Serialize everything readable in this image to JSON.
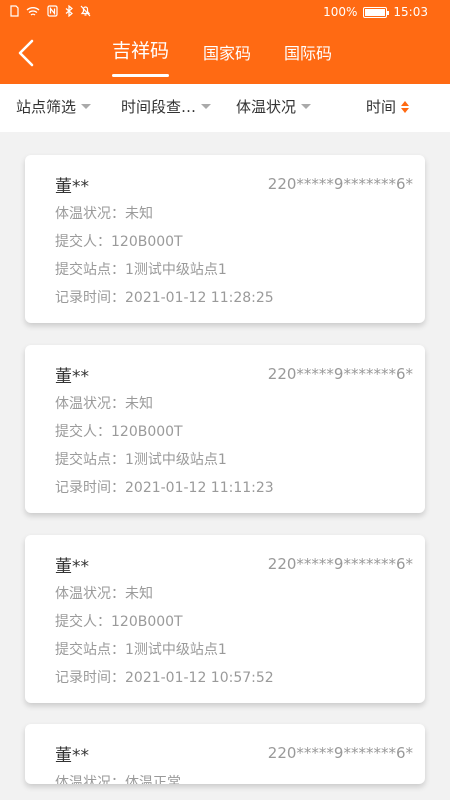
{
  "status_bar": {
    "left_icons": [
      "sim-icon",
      "wifi-icon",
      "nfc-icon",
      "bluetooth-icon",
      "mute-icon"
    ],
    "battery_text": "100%",
    "battery_level": 1.0,
    "time": "15:03"
  },
  "header": {
    "accent_color": "#ff6a13",
    "tabs": [
      {
        "label": "吉祥码",
        "active": true
      },
      {
        "label": "国家码",
        "active": false
      },
      {
        "label": "国际码",
        "active": false
      }
    ]
  },
  "filters": {
    "station": "站点筛选",
    "time_range": "时间段查…",
    "temperature": "体温状况",
    "sort_time": "时间"
  },
  "records": [
    {
      "name": "董**",
      "id": "220*****9*******6*",
      "temp_label": "体温状况：",
      "temp": "未知",
      "submitter_label": "提交人：",
      "submitter": "120B000T",
      "station_label": "提交站点：",
      "station": "1测试中级站点1",
      "time_label": "记录时间：",
      "time": "2021-01-12 11:28:25"
    },
    {
      "name": "董**",
      "id": "220*****9*******6*",
      "temp_label": "体温状况：",
      "temp": "未知",
      "submitter_label": "提交人：",
      "submitter": "120B000T",
      "station_label": "提交站点：",
      "station": "1测试中级站点1",
      "time_label": "记录时间：",
      "time": "2021-01-12 11:11:23"
    },
    {
      "name": "董**",
      "id": "220*****9*******6*",
      "temp_label": "体温状况：",
      "temp": "未知",
      "submitter_label": "提交人：",
      "submitter": "120B000T",
      "station_label": "提交站点：",
      "station": "1测试中级站点1",
      "time_label": "记录时间：",
      "time": "2021-01-12 10:57:52"
    },
    {
      "name": "董**",
      "id": "220*****9*******6*",
      "temp_label": "体温状况：",
      "temp": "体温正常"
    }
  ]
}
